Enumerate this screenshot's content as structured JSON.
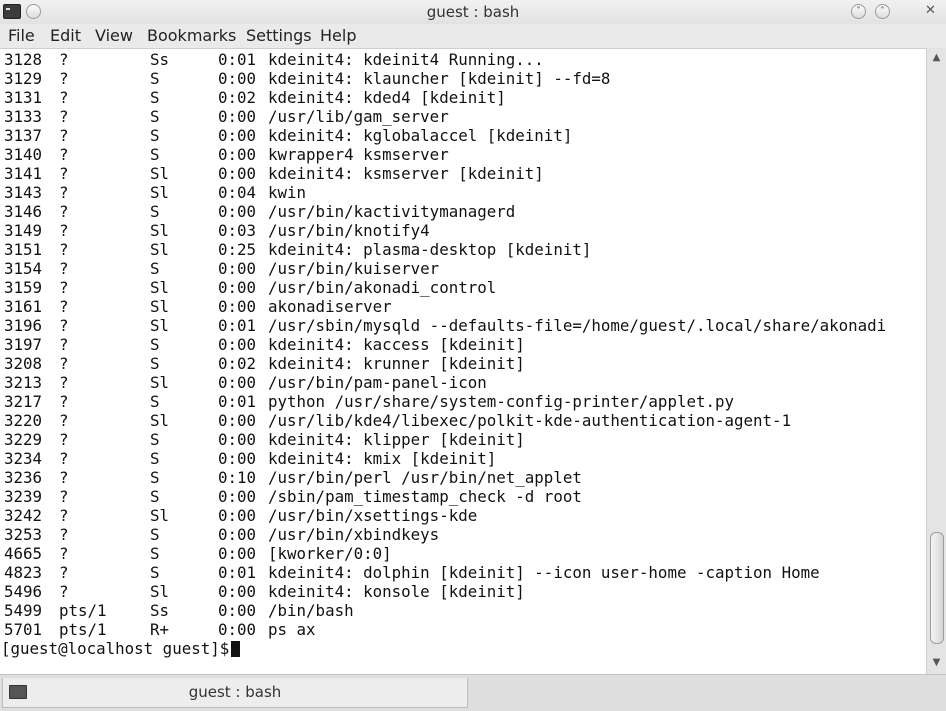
{
  "window": {
    "title": "guest : bash",
    "icon": "terminal-icon",
    "buttons": {
      "minimize": "˅",
      "maximize": "˄",
      "close": "✕"
    }
  },
  "menu": [
    "File",
    "Edit",
    "View",
    "Bookmarks",
    "Settings",
    "Help"
  ],
  "processes": [
    {
      "pid": "3128",
      "tty": "?",
      "stat": "Ss",
      "time": "0:01",
      "cmd": "kdeinit4: kdeinit4 Running..."
    },
    {
      "pid": "3129",
      "tty": "?",
      "stat": "S",
      "time": "0:00",
      "cmd": "kdeinit4: klauncher [kdeinit] --fd=8"
    },
    {
      "pid": "3131",
      "tty": "?",
      "stat": "S",
      "time": "0:02",
      "cmd": "kdeinit4: kded4 [kdeinit]"
    },
    {
      "pid": "3133",
      "tty": "?",
      "stat": "S",
      "time": "0:00",
      "cmd": "/usr/lib/gam_server"
    },
    {
      "pid": "3137",
      "tty": "?",
      "stat": "S",
      "time": "0:00",
      "cmd": "kdeinit4: kglobalaccel [kdeinit]"
    },
    {
      "pid": "3140",
      "tty": "?",
      "stat": "S",
      "time": "0:00",
      "cmd": "kwrapper4 ksmserver"
    },
    {
      "pid": "3141",
      "tty": "?",
      "stat": "Sl",
      "time": "0:00",
      "cmd": "kdeinit4: ksmserver [kdeinit]"
    },
    {
      "pid": "3143",
      "tty": "?",
      "stat": "Sl",
      "time": "0:04",
      "cmd": "kwin"
    },
    {
      "pid": "3146",
      "tty": "?",
      "stat": "S",
      "time": "0:00",
      "cmd": "/usr/bin/kactivitymanagerd"
    },
    {
      "pid": "3149",
      "tty": "?",
      "stat": "Sl",
      "time": "0:03",
      "cmd": "/usr/bin/knotify4"
    },
    {
      "pid": "3151",
      "tty": "?",
      "stat": "Sl",
      "time": "0:25",
      "cmd": "kdeinit4: plasma-desktop [kdeinit]"
    },
    {
      "pid": "3154",
      "tty": "?",
      "stat": "S",
      "time": "0:00",
      "cmd": "/usr/bin/kuiserver"
    },
    {
      "pid": "3159",
      "tty": "?",
      "stat": "Sl",
      "time": "0:00",
      "cmd": "/usr/bin/akonadi_control"
    },
    {
      "pid": "3161",
      "tty": "?",
      "stat": "Sl",
      "time": "0:00",
      "cmd": "akonadiserver"
    },
    {
      "pid": "3196",
      "tty": "?",
      "stat": "Sl",
      "time": "0:01",
      "cmd": "/usr/sbin/mysqld --defaults-file=/home/guest/.local/share/akonadi"
    },
    {
      "pid": "3197",
      "tty": "?",
      "stat": "S",
      "time": "0:00",
      "cmd": "kdeinit4: kaccess [kdeinit]"
    },
    {
      "pid": "3208",
      "tty": "?",
      "stat": "S",
      "time": "0:02",
      "cmd": "kdeinit4: krunner [kdeinit]"
    },
    {
      "pid": "3213",
      "tty": "?",
      "stat": "Sl",
      "time": "0:00",
      "cmd": "/usr/bin/pam-panel-icon"
    },
    {
      "pid": "3217",
      "tty": "?",
      "stat": "S",
      "time": "0:01",
      "cmd": "python /usr/share/system-config-printer/applet.py"
    },
    {
      "pid": "3220",
      "tty": "?",
      "stat": "Sl",
      "time": "0:00",
      "cmd": "/usr/lib/kde4/libexec/polkit-kde-authentication-agent-1"
    },
    {
      "pid": "3229",
      "tty": "?",
      "stat": "S",
      "time": "0:00",
      "cmd": "kdeinit4: klipper [kdeinit]"
    },
    {
      "pid": "3234",
      "tty": "?",
      "stat": "S",
      "time": "0:00",
      "cmd": "kdeinit4: kmix [kdeinit]"
    },
    {
      "pid": "3236",
      "tty": "?",
      "stat": "S",
      "time": "0:10",
      "cmd": "/usr/bin/perl /usr/bin/net_applet"
    },
    {
      "pid": "3239",
      "tty": "?",
      "stat": "S",
      "time": "0:00",
      "cmd": "/sbin/pam_timestamp_check -d root"
    },
    {
      "pid": "3242",
      "tty": "?",
      "stat": "Sl",
      "time": "0:00",
      "cmd": "/usr/bin/xsettings-kde"
    },
    {
      "pid": "3253",
      "tty": "?",
      "stat": "S",
      "time": "0:00",
      "cmd": "/usr/bin/xbindkeys"
    },
    {
      "pid": "4665",
      "tty": "?",
      "stat": "S",
      "time": "0:00",
      "cmd": "[kworker/0:0]"
    },
    {
      "pid": "4823",
      "tty": "?",
      "stat": "S",
      "time": "0:01",
      "cmd": "kdeinit4: dolphin [kdeinit] --icon user-home -caption Home"
    },
    {
      "pid": "5496",
      "tty": "?",
      "stat": "Sl",
      "time": "0:00",
      "cmd": "kdeinit4: konsole [kdeinit]"
    },
    {
      "pid": "5499",
      "tty": "pts/1",
      "stat": "Ss",
      "time": "0:00",
      "cmd": "/bin/bash"
    },
    {
      "pid": "5701",
      "tty": "pts/1",
      "stat": "R+",
      "time": "0:00",
      "cmd": "ps ax"
    }
  ],
  "prompt": "[guest@localhost guest]$",
  "scrollbar": {
    "up": "▲",
    "down": "▼"
  },
  "tab": {
    "label": "guest : bash",
    "icon": "terminal-icon"
  }
}
